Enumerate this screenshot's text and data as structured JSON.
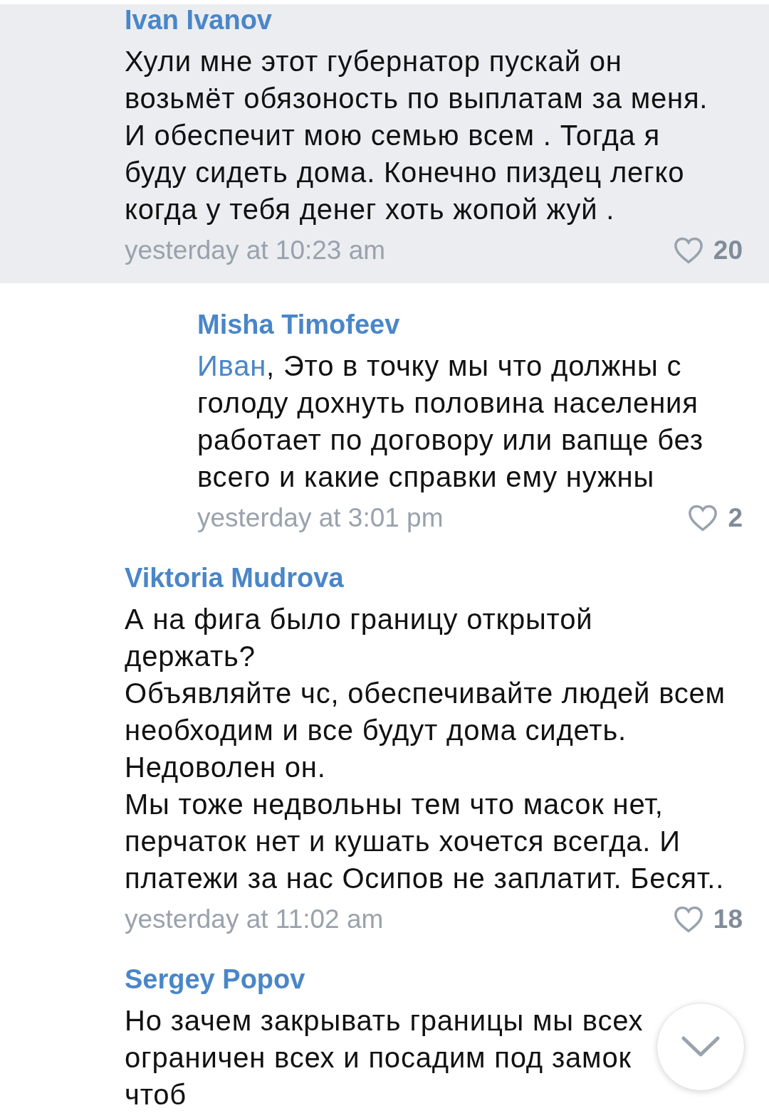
{
  "comments": [
    {
      "kind": "comment",
      "highlighted": true,
      "author": "Ivan Ivanov",
      "text": "Хули мне этот губернатор пускай он\nвозьмёт обязоность по выплатам за меня.\nИ обеспечит мою семью всем . Тогда я\nбуду сидеть дома. Конечно пиздец легко\nкогда у тебя денег хоть жопой жуй .",
      "date": "yesterday at 10:23 am",
      "likes": "20"
    },
    {
      "kind": "reply",
      "highlighted": false,
      "author": "Misha Timofeev",
      "mention": "Иван",
      "text": ", Это в точку мы что должны с\nголоду дохнуть половина населения\nработает по договору или вапще без\nвсего и какие справки ему нужны",
      "date": "yesterday at 3:01 pm",
      "likes": "2"
    },
    {
      "kind": "comment",
      "highlighted": false,
      "author": "Viktoria Mudrova",
      "text": "А на фига было границу открытой\nдержать?\nОбъявляйте чс, обеспечивайте людей всем\nнеобходим и все будут дома сидеть.\nНедоволен он.\nМы тоже недвольны тем что масок нет,\nперчаток нет и кушать хочется всегда. И\nплатежи за нас Осипов не заплатит. Бесят..",
      "date": "yesterday at 11:02 am",
      "likes": "18"
    },
    {
      "kind": "comment",
      "highlighted": false,
      "author": "Sergey Popov",
      "text": "Но зачем закрывать границы мы всех\nограничен всех и посадим под замок чтоб"
    }
  ]
}
